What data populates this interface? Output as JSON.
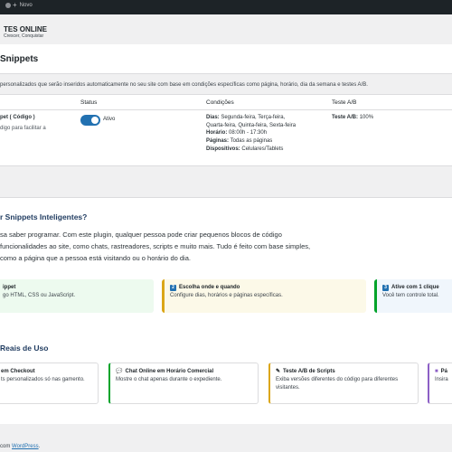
{
  "adminbar": {
    "new_label": "Novo"
  },
  "brand": {
    "title": "TES ONLINE",
    "tagline": "Crescer, Conquistar"
  },
  "page": {
    "title": "Snippets",
    "description": "personalizados que serão inseridos automaticamente no seu site com base em condições específicas como página, horário, dia da semana e testes A/B."
  },
  "table": {
    "headers": {
      "status": "Status",
      "conditions": "Condições",
      "ab": "Teste A/B"
    },
    "row": {
      "name": "pet ( Código )",
      "desc": "digo para facilitar a",
      "status": "Ativo",
      "cond_days_label": "Dias:",
      "cond_days_1": "Segunda-feira, Terça-feira,",
      "cond_days_2": "Quarta-feira, Quinta-feira, Sexta-feira",
      "cond_time_label": "Horário:",
      "cond_time": "08:00h - 17:30h",
      "cond_pages_label": "Páginas:",
      "cond_pages": "Todas as páginas",
      "cond_devices_label": "Dispositivos:",
      "cond_devices": "Celulares/Tablets",
      "ab_label": "Teste A/B:",
      "ab_value": "100%"
    }
  },
  "info": {
    "heading": "r Snippets Inteligentes?",
    "intro": "sa saber programar. Com este plugin, qualquer pessoa pode criar pequenos blocos de código funcionalidades ao site, como chats, rastreadores, scripts e muito mais. Tudo é feito com base simples, como a página que a pessoa está visitando ou o horário do dia.",
    "steps": [
      {
        "title": "ippet",
        "desc": "go HTML, CSS ou JavaScript.",
        "badge": ""
      },
      {
        "title": "Escolha onde e quando",
        "desc": "Configure dias, horários e páginas específicas.",
        "badge": "2"
      },
      {
        "title": "Ative com 1 clique",
        "desc": "Você tem controle total.",
        "badge": "3"
      }
    ],
    "uses_heading": "Reais de Uso",
    "uses": [
      {
        "title": "em Checkout",
        "desc": "ts personalizados só nas gamento.",
        "icon": ""
      },
      {
        "title": "Chat Online em Horário Comercial",
        "desc": "Mostre o chat apenas durante o expediente.",
        "icon": "chat-icon"
      },
      {
        "title": "Teste A/B de Scripts",
        "desc": "Exiba versões diferentes do código para diferentes visitantes.",
        "icon": "pencil-icon"
      },
      {
        "title": "Pá",
        "desc": "Insira",
        "icon": "puzzle-icon"
      }
    ]
  },
  "footer": {
    "prefix": "com",
    "link": "WordPress",
    "suffix": "."
  },
  "colors": {
    "accent": "#2271b1",
    "green": "#00a32a",
    "yellow": "#dba617",
    "purple": "#8c5fc6"
  }
}
